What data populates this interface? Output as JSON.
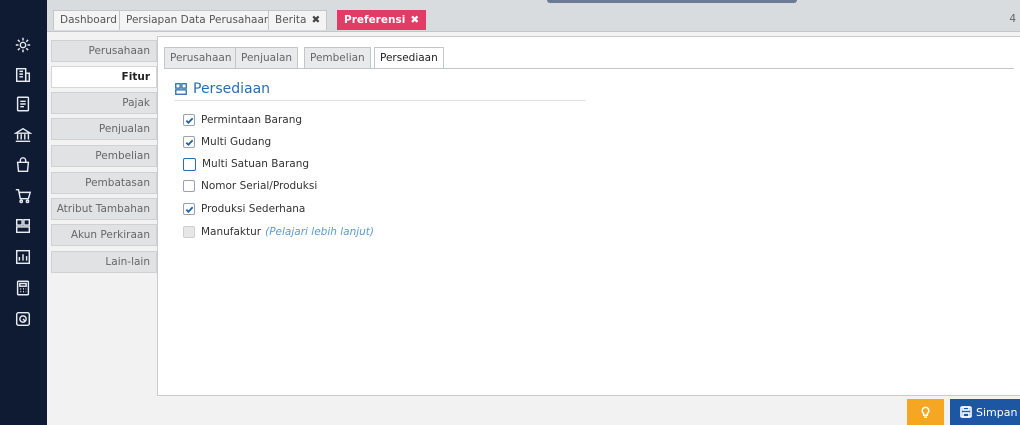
{
  "top_tabs": [
    {
      "label": "Dashboard",
      "closable": false
    },
    {
      "label": "Persiapan Data Perusahaan",
      "closable": false
    },
    {
      "label": "Berita",
      "closable": true
    },
    {
      "label": "Preferensi",
      "closable": true,
      "active": true
    }
  ],
  "top_tabs_close": "✖",
  "top_right_count": "4",
  "rail_icons": [
    "settings-icon",
    "company-icon",
    "document-icon",
    "bank-icon",
    "bag-icon",
    "cart-icon",
    "inventory-icon",
    "report-icon",
    "calculator-icon",
    "headset-icon"
  ],
  "menu": [
    {
      "label": "Perusahaan"
    },
    {
      "label": "Fitur",
      "active": true
    },
    {
      "label": "Pajak"
    },
    {
      "label": "Penjualan"
    },
    {
      "label": "Pembelian"
    },
    {
      "label": "Pembatasan"
    },
    {
      "label": "Atribut Tambahan"
    },
    {
      "label": "Akun Perkiraan"
    },
    {
      "label": "Lain-lain"
    }
  ],
  "sub_tabs": [
    {
      "label": "Perusahaan"
    },
    {
      "label": "Penjualan"
    },
    {
      "label": "Pembelian"
    },
    {
      "label": "Persediaan",
      "active": true
    }
  ],
  "section": {
    "title": "Persediaan",
    "icon": "inventory-icon"
  },
  "options": [
    {
      "label": "Permintaan Barang",
      "checked": true
    },
    {
      "label": "Multi Gudang",
      "checked": true
    },
    {
      "label": "Multi Satuan Barang",
      "checked": false,
      "focused": true
    },
    {
      "label": "Nomor Serial/Produksi",
      "checked": false
    },
    {
      "label": "Produksi Sederhana",
      "checked": true
    },
    {
      "label": "Manufaktur",
      "checked": false,
      "disabled": true,
      "link": "(Pelajari lebih lanjut)"
    }
  ],
  "buttons": {
    "tip_icon": "lightbulb-icon",
    "save_label": "Simpan"
  },
  "colors": {
    "rail": "#0e1b33",
    "active_tab": "#e13c66",
    "accent": "#2b6db4",
    "save": "#1d57a3",
    "tip": "#f5a623"
  }
}
